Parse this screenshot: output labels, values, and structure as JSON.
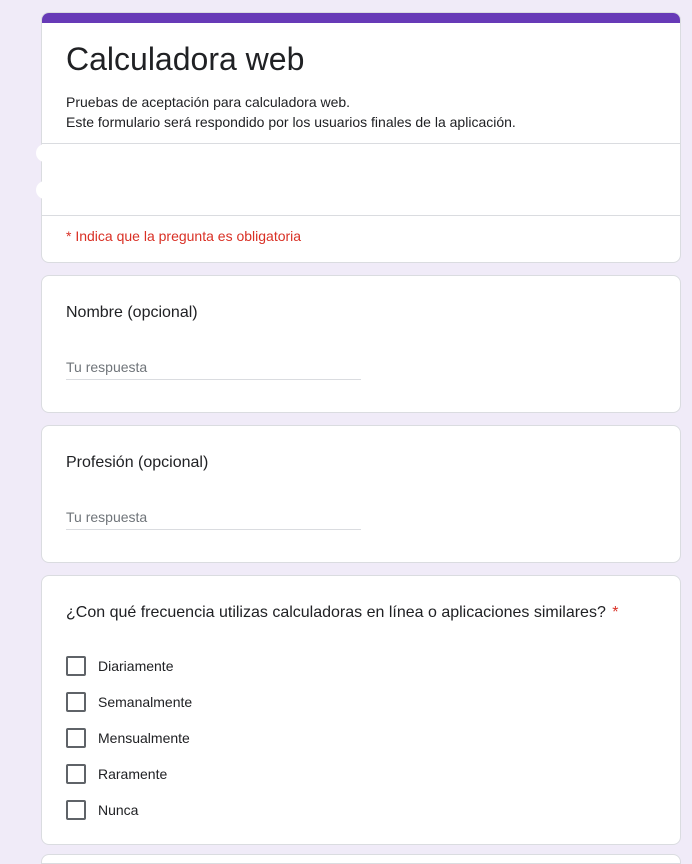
{
  "form": {
    "title": "Calculadora web",
    "description_line1": "Pruebas de aceptación para calculadora web.",
    "description_line2": "Este formulario será respondido por los usuarios finales de la aplicación.",
    "required_note": "* Indica que la pregunta es obligatoria"
  },
  "questions": [
    {
      "title": "Nombre (opcional)",
      "placeholder": "Tu respuesta",
      "value": ""
    },
    {
      "title": "Profesión (opcional)",
      "placeholder": "Tu respuesta",
      "value": ""
    },
    {
      "title": "¿Con qué frecuencia utilizas calculadoras en línea o aplicaciones similares?",
      "required_mark": "*",
      "options": [
        {
          "label": "Diariamente",
          "checked": false
        },
        {
          "label": "Semanalmente",
          "checked": false
        },
        {
          "label": "Mensualmente",
          "checked": false
        },
        {
          "label": "Raramente",
          "checked": false
        },
        {
          "label": "Nunca",
          "checked": false
        }
      ]
    }
  ],
  "colors": {
    "accent": "#673ab7",
    "background": "#f0ebf8",
    "required": "#d93025",
    "border": "#dadce0"
  },
  "icons": {
    "checkbox": "checkbox-unchecked-icon"
  }
}
